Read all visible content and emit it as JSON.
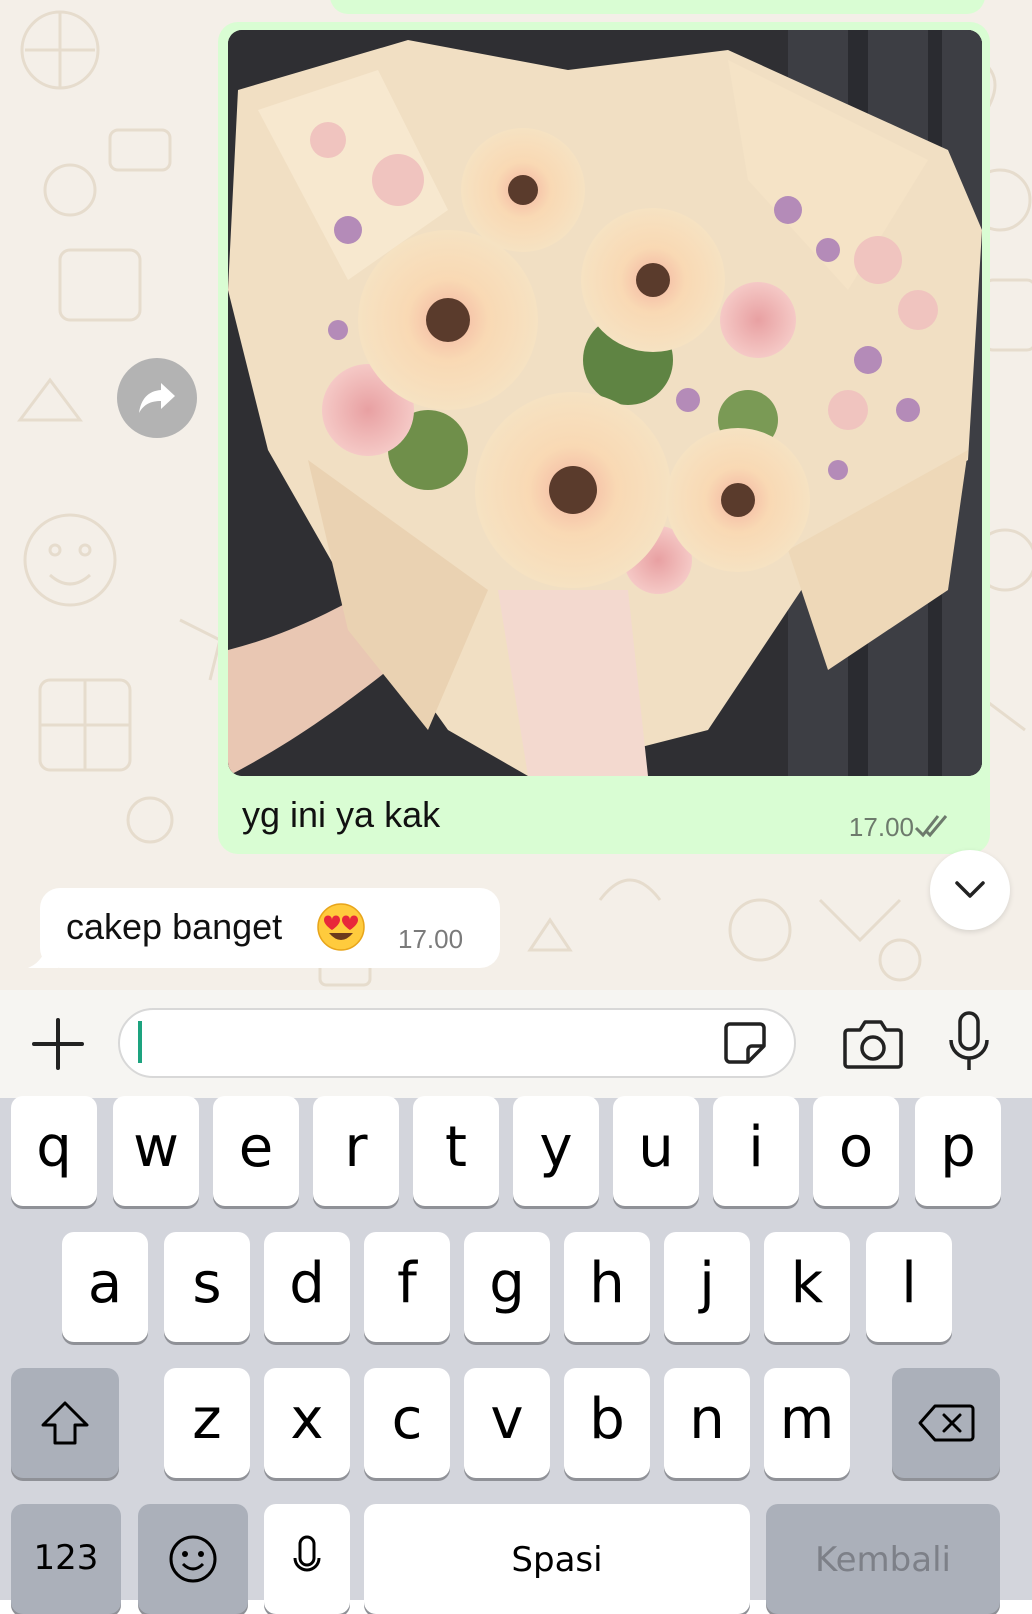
{
  "chat": {
    "outgoing": {
      "caption": "yg ini ya kak",
      "time": "17.00",
      "status_icon": "double-check-icon"
    },
    "incoming": {
      "text": "cakep banget",
      "emoji": "heart-eyes-emoji",
      "time": "17.00"
    }
  },
  "input": {
    "value": "",
    "placeholder": ""
  },
  "keyboard": {
    "row1": [
      "q",
      "w",
      "e",
      "r",
      "t",
      "y",
      "u",
      "i",
      "o",
      "p"
    ],
    "row2": [
      "a",
      "s",
      "d",
      "f",
      "g",
      "h",
      "j",
      "k",
      "l"
    ],
    "row3": [
      "z",
      "x",
      "c",
      "v",
      "b",
      "n",
      "m"
    ],
    "numbers_label": "123",
    "space_label": "Spasi",
    "return_label": "Kembali"
  },
  "colors": {
    "outgoing_bubble": "#d9fdd3",
    "chat_background": "#f4efe8",
    "caret": "#1da37f",
    "keyboard_background": "#d3d5dc"
  }
}
